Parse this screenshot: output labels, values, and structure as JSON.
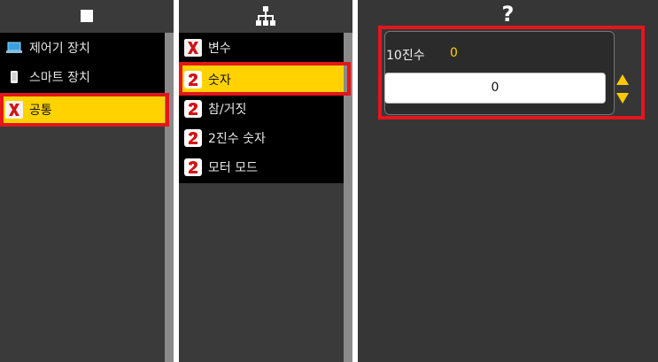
{
  "panel_left": {
    "header_icon": "square-icon",
    "items": [
      {
        "label": "제어기 장치",
        "icon": "monitor-icon"
      },
      {
        "label": "스마트 장치",
        "icon": "phone-icon"
      },
      {
        "label": "공통",
        "icon": "red-x-icon",
        "selected": true
      }
    ]
  },
  "panel_middle": {
    "header_icon": "hierarchy-icon",
    "items": [
      {
        "label": "변수",
        "icon": "red-x-icon"
      },
      {
        "label": "숫자",
        "icon": "number-two-icon",
        "selected": true
      },
      {
        "label": "참/거짓",
        "icon": "number-two-icon"
      },
      {
        "label": "2진수 숫자",
        "icon": "number-two-icon"
      },
      {
        "label": "모터 모드",
        "icon": "number-two-icon"
      }
    ]
  },
  "panel_right": {
    "header_icon": "question-icon",
    "header_text": "?",
    "field_label": "10진수",
    "field_value": "0",
    "input_value": "0"
  },
  "colors": {
    "selected_bg": "#ffd200",
    "highlight_outline": "#e3161b",
    "value_yellow": "#ffd200",
    "panel_bg": "#3a3a3a"
  }
}
